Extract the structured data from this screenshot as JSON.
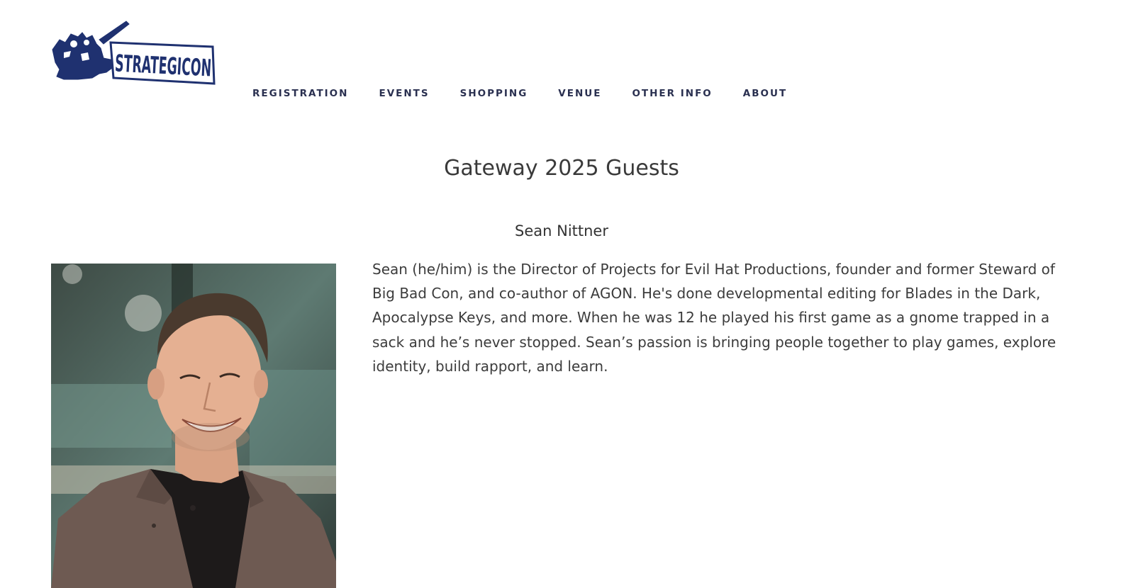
{
  "logo": {
    "text": "STRATEGICON",
    "brand_color": "#1f3170"
  },
  "nav": {
    "items": [
      {
        "label": "REGISTRATION"
      },
      {
        "label": "EVENTS"
      },
      {
        "label": "SHOPPING"
      },
      {
        "label": "VENUE"
      },
      {
        "label": "OTHER INFO"
      },
      {
        "label": "ABOUT"
      }
    ],
    "color": "#2a3050"
  },
  "main": {
    "title": "Gateway 2025 Guests",
    "guest": {
      "name": "Sean Nittner",
      "bio": "Sean (he/him) is the Director of Projects for Evil Hat Productions, founder and former Steward of Big Bad Con, and co-author of AGON. He's done developmental editing for Blades in the Dark, Apocalypse Keys, and more. When he was 12 he played his first game as a gnome trapped in a sack and he’s never stopped. Sean’s passion is bringing people together to play games, explore identity, build rapport, and learn."
    }
  }
}
